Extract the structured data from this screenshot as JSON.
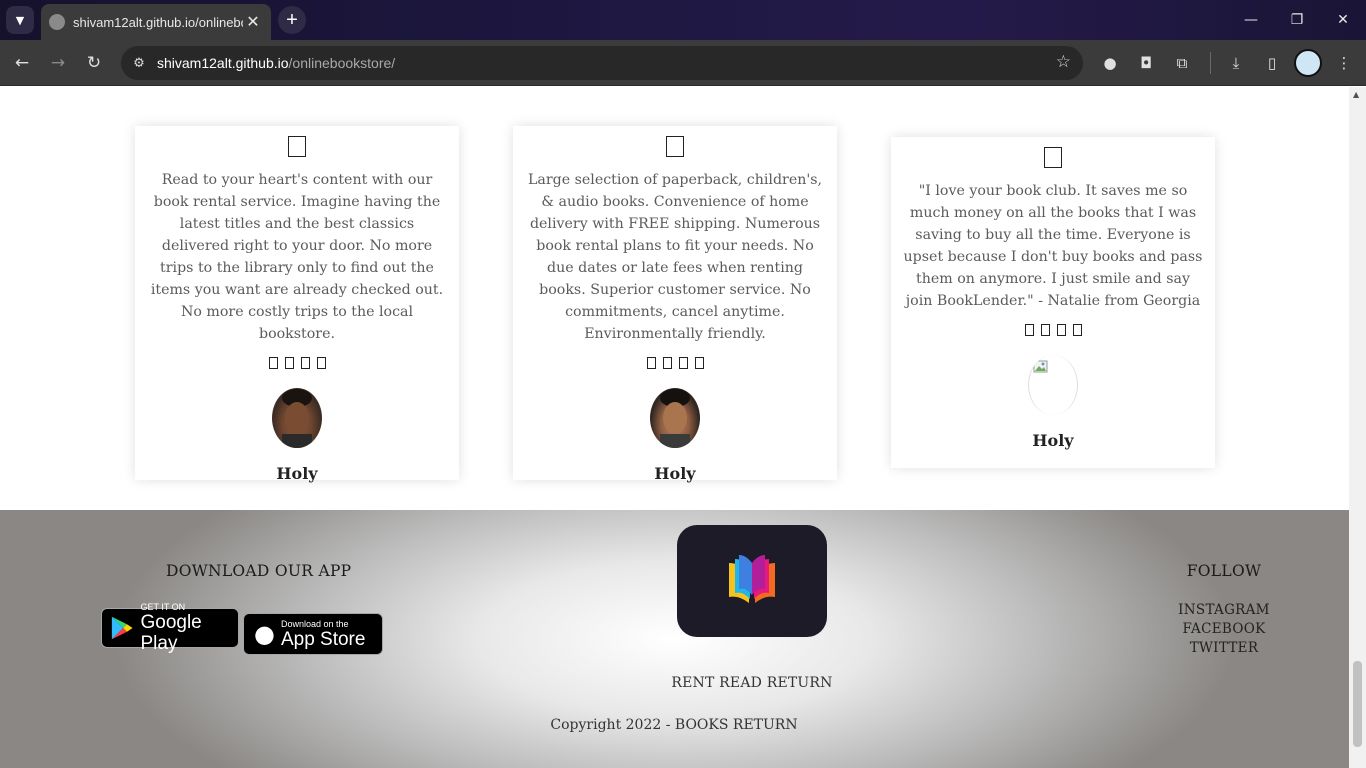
{
  "browser": {
    "tab_title": "shivam12alt.github.io/onlinebookstore/",
    "tab_close": "✕",
    "new_tab": "+",
    "url_host": "shivam12alt.github.io",
    "url_path": "/onlinebookstore/"
  },
  "testimonials": [
    {
      "text": "Read to your heart's content with our book rental service. Imagine having the latest titles and the best classics delivered right to your door. No more trips to the library only to find out the items you want are already checked out. No more costly trips to the local bookstore.",
      "name": "Holy",
      "avatar_icon": "person-photo",
      "stars": 4
    },
    {
      "text": "Large selection of paperback, children's, & audio books. Convenience of home delivery with FREE shipping. Numerous book rental plans to fit your needs. No due dates or late fees when renting books. Superior customer service. No commitments, cancel anytime. Environmentally friendly.",
      "name": "Holy",
      "avatar_icon": "person-photo",
      "stars": 4
    },
    {
      "text": "\"I love your book club. It saves me so much money on all the books that I was saving to buy all the time. Everyone is upset because I don't buy books and pass them on anymore. I just smile and say join BookLender.\" - Natalie from Georgia",
      "name": "Holy",
      "avatar_icon": "broken-image",
      "stars": 4
    }
  ],
  "footer": {
    "download_heading": "DOWNLOAD OUR APP",
    "google_play": {
      "small": "GET IT ON",
      "big": "Google Play"
    },
    "app_store": {
      "small": "Download on the",
      "big": "App Store"
    },
    "tagline": "RENT READ RETURN",
    "copyright": "Copyright 2022 - BOOKS RETURN",
    "follow_heading": "FOLLOW",
    "follow_links": [
      "INSTAGRAM",
      "FACEBOOK",
      "TWITTER"
    ]
  },
  "colors": {
    "logo_bg": "#1c1b27",
    "logo_cyan": "#1fb6e8",
    "logo_magenta": "#e6197d",
    "logo_yellow": "#f6c21b",
    "logo_orange": "#f26b21"
  }
}
